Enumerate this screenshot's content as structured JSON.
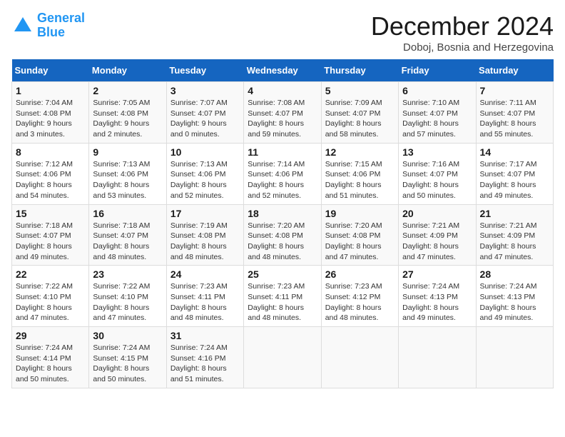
{
  "logo": {
    "line1": "General",
    "line2": "Blue"
  },
  "title": "December 2024",
  "location": "Doboj, Bosnia and Herzegovina",
  "days_of_week": [
    "Sunday",
    "Monday",
    "Tuesday",
    "Wednesday",
    "Thursday",
    "Friday",
    "Saturday"
  ],
  "weeks": [
    [
      {
        "day": 1,
        "sunrise": "7:04 AM",
        "sunset": "4:08 PM",
        "daylight": "9 hours and 3 minutes."
      },
      {
        "day": 2,
        "sunrise": "7:05 AM",
        "sunset": "4:08 PM",
        "daylight": "9 hours and 2 minutes."
      },
      {
        "day": 3,
        "sunrise": "7:07 AM",
        "sunset": "4:07 PM",
        "daylight": "9 hours and 0 minutes."
      },
      {
        "day": 4,
        "sunrise": "7:08 AM",
        "sunset": "4:07 PM",
        "daylight": "8 hours and 59 minutes."
      },
      {
        "day": 5,
        "sunrise": "7:09 AM",
        "sunset": "4:07 PM",
        "daylight": "8 hours and 58 minutes."
      },
      {
        "day": 6,
        "sunrise": "7:10 AM",
        "sunset": "4:07 PM",
        "daylight": "8 hours and 57 minutes."
      },
      {
        "day": 7,
        "sunrise": "7:11 AM",
        "sunset": "4:07 PM",
        "daylight": "8 hours and 55 minutes."
      }
    ],
    [
      {
        "day": 8,
        "sunrise": "7:12 AM",
        "sunset": "4:06 PM",
        "daylight": "8 hours and 54 minutes."
      },
      {
        "day": 9,
        "sunrise": "7:13 AM",
        "sunset": "4:06 PM",
        "daylight": "8 hours and 53 minutes."
      },
      {
        "day": 10,
        "sunrise": "7:13 AM",
        "sunset": "4:06 PM",
        "daylight": "8 hours and 52 minutes."
      },
      {
        "day": 11,
        "sunrise": "7:14 AM",
        "sunset": "4:06 PM",
        "daylight": "8 hours and 52 minutes."
      },
      {
        "day": 12,
        "sunrise": "7:15 AM",
        "sunset": "4:06 PM",
        "daylight": "8 hours and 51 minutes."
      },
      {
        "day": 13,
        "sunrise": "7:16 AM",
        "sunset": "4:07 PM",
        "daylight": "8 hours and 50 minutes."
      },
      {
        "day": 14,
        "sunrise": "7:17 AM",
        "sunset": "4:07 PM",
        "daylight": "8 hours and 49 minutes."
      }
    ],
    [
      {
        "day": 15,
        "sunrise": "7:18 AM",
        "sunset": "4:07 PM",
        "daylight": "8 hours and 49 minutes."
      },
      {
        "day": 16,
        "sunrise": "7:18 AM",
        "sunset": "4:07 PM",
        "daylight": "8 hours and 48 minutes."
      },
      {
        "day": 17,
        "sunrise": "7:19 AM",
        "sunset": "4:08 PM",
        "daylight": "8 hours and 48 minutes."
      },
      {
        "day": 18,
        "sunrise": "7:20 AM",
        "sunset": "4:08 PM",
        "daylight": "8 hours and 48 minutes."
      },
      {
        "day": 19,
        "sunrise": "7:20 AM",
        "sunset": "4:08 PM",
        "daylight": "8 hours and 47 minutes."
      },
      {
        "day": 20,
        "sunrise": "7:21 AM",
        "sunset": "4:09 PM",
        "daylight": "8 hours and 47 minutes."
      },
      {
        "day": 21,
        "sunrise": "7:21 AM",
        "sunset": "4:09 PM",
        "daylight": "8 hours and 47 minutes."
      }
    ],
    [
      {
        "day": 22,
        "sunrise": "7:22 AM",
        "sunset": "4:10 PM",
        "daylight": "8 hours and 47 minutes."
      },
      {
        "day": 23,
        "sunrise": "7:22 AM",
        "sunset": "4:10 PM",
        "daylight": "8 hours and 47 minutes."
      },
      {
        "day": 24,
        "sunrise": "7:23 AM",
        "sunset": "4:11 PM",
        "daylight": "8 hours and 48 minutes."
      },
      {
        "day": 25,
        "sunrise": "7:23 AM",
        "sunset": "4:11 PM",
        "daylight": "8 hours and 48 minutes."
      },
      {
        "day": 26,
        "sunrise": "7:23 AM",
        "sunset": "4:12 PM",
        "daylight": "8 hours and 48 minutes."
      },
      {
        "day": 27,
        "sunrise": "7:24 AM",
        "sunset": "4:13 PM",
        "daylight": "8 hours and 49 minutes."
      },
      {
        "day": 28,
        "sunrise": "7:24 AM",
        "sunset": "4:13 PM",
        "daylight": "8 hours and 49 minutes."
      }
    ],
    [
      {
        "day": 29,
        "sunrise": "7:24 AM",
        "sunset": "4:14 PM",
        "daylight": "8 hours and 50 minutes."
      },
      {
        "day": 30,
        "sunrise": "7:24 AM",
        "sunset": "4:15 PM",
        "daylight": "8 hours and 50 minutes."
      },
      {
        "day": 31,
        "sunrise": "7:24 AM",
        "sunset": "4:16 PM",
        "daylight": "8 hours and 51 minutes."
      },
      null,
      null,
      null,
      null
    ]
  ]
}
